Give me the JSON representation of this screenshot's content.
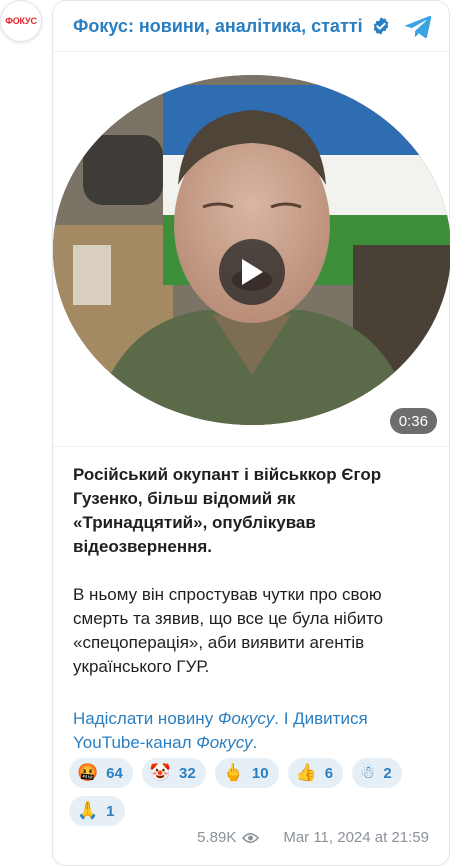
{
  "channel": {
    "avatar_text": "ФОКУС",
    "title": "Фокус: новини, аналітика, статті",
    "brand_color": "#2a7fc2",
    "logo_color": "#e4232d"
  },
  "video": {
    "duration": "0:36",
    "play_icon": "play-icon"
  },
  "post": {
    "lead": "Російський окупант і військкор Єгор Гузенко, більш відомий як «Тринадцятий», опублікував відеозвернення.",
    "body": "В ньому він спростував чутки про свою смерть та зявив, що все це була нібито «спецоперація», аби виявити агентів українського ГУР.",
    "links": {
      "send_prefix": "Надіслати новину ",
      "send_emph": "Фокусу",
      "send_suffix": ".",
      "separator": " І ",
      "watch_prefix": "Дивитися YouTube-канал ",
      "watch_emph": "Фокусу",
      "watch_suffix": "."
    }
  },
  "reactions": [
    {
      "emoji": "🤬",
      "count": "64"
    },
    {
      "emoji": "🤡",
      "count": "32"
    },
    {
      "emoji": "🖕",
      "count": "10"
    },
    {
      "emoji": "👍",
      "count": "6"
    },
    {
      "emoji": "☃",
      "count": "2"
    },
    {
      "emoji": "🙏",
      "count": "1"
    }
  ],
  "meta": {
    "views": "5.89K",
    "date": "Mar 11, 2024 at 21:59"
  }
}
